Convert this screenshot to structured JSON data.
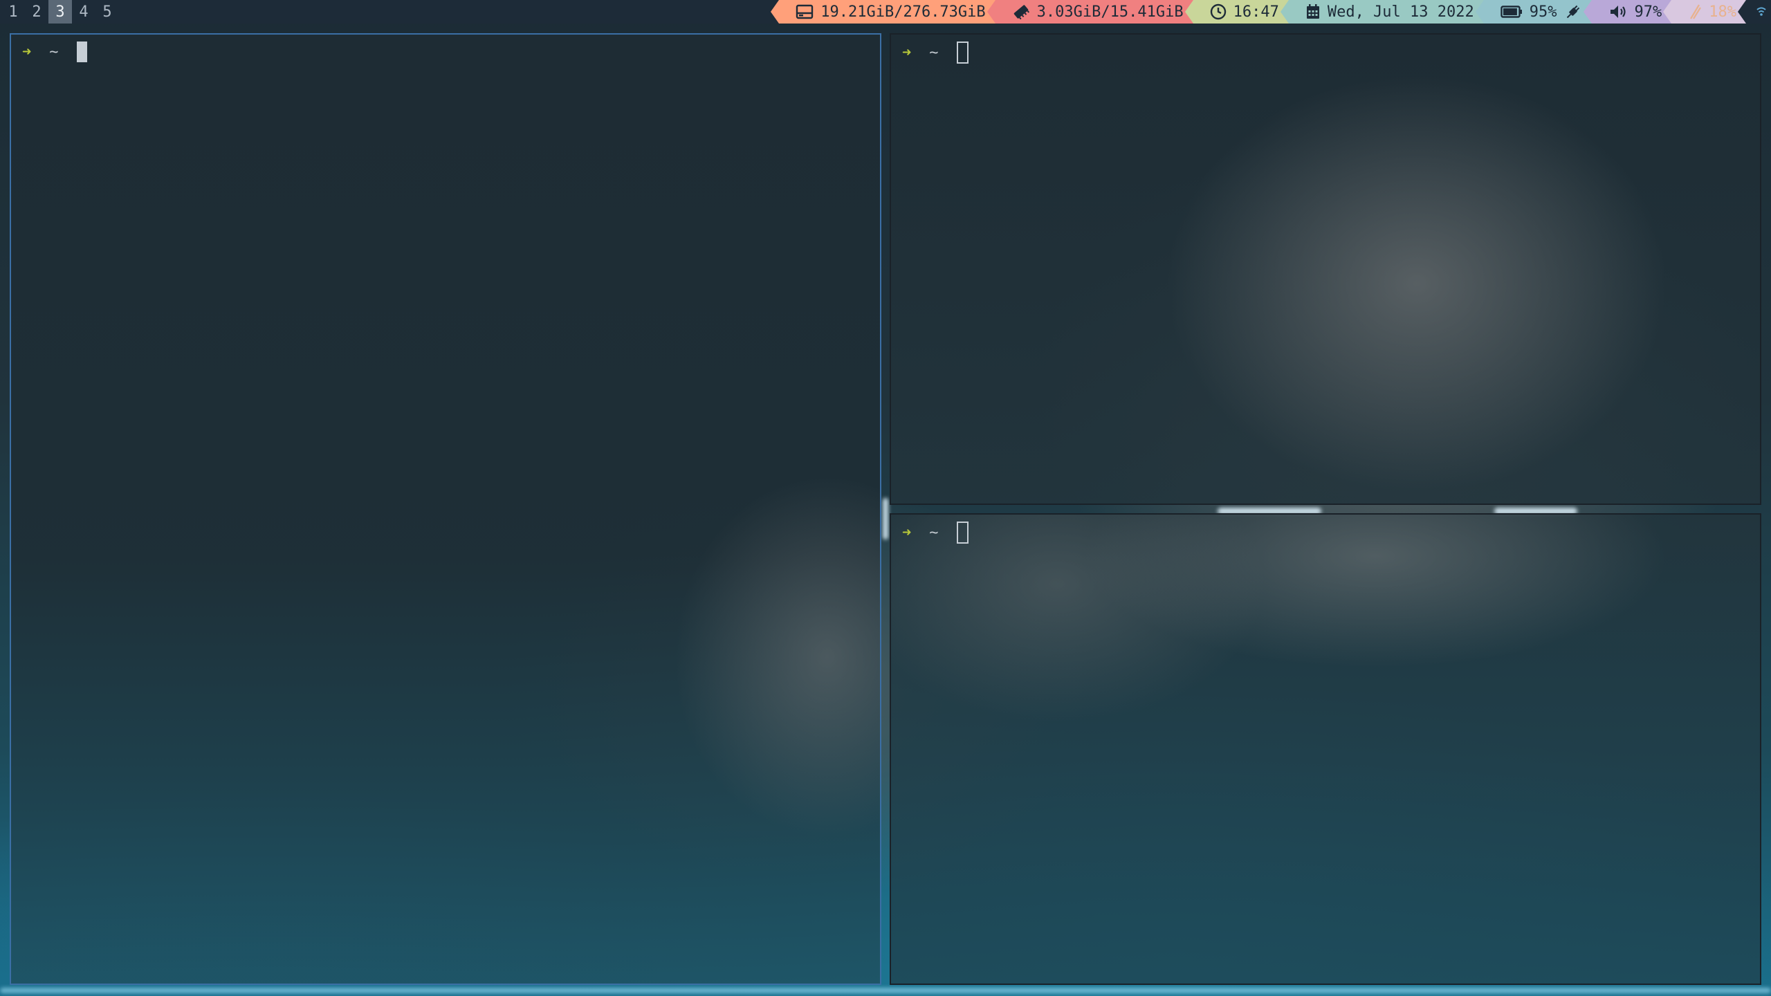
{
  "workspaces": [
    "1",
    "2",
    "3",
    "4",
    "5"
  ],
  "active_workspace": "3",
  "status": {
    "disk": {
      "icon": "disk-icon",
      "text": "19.21GiB/276.73GiB",
      "color": "#ffa07a"
    },
    "memory": {
      "icon": "memory-icon",
      "text": "3.03GiB/15.41GiB",
      "color": "#f08080"
    },
    "clock": {
      "icon": "clock-icon",
      "text": "16:47",
      "color": "#c9d69a"
    },
    "date": {
      "icon": "calendar-icon",
      "text": "Wed, Jul 13 2022",
      "color": "#99c9c3"
    },
    "battery": {
      "icon": "battery-icon",
      "text": "95%",
      "color": "#94c4cc",
      "level": 0.95
    },
    "charging": {
      "icon": "plug-icon",
      "color": "#94c4cc"
    },
    "volume": {
      "icon": "speaker-icon",
      "text": "97%",
      "color": "#b9a8d8"
    },
    "brightness": {
      "icon": "brightness-icon",
      "text": "18%",
      "color": "#d9c8e0"
    },
    "network": {
      "icon": "wifi-icon"
    }
  },
  "terminals": [
    {
      "prompt_symbol": "➜",
      "cwd": "~"
    },
    {
      "prompt_symbol": "➜",
      "cwd": "~"
    },
    {
      "prompt_symbol": "➜",
      "cwd": "~"
    }
  ]
}
